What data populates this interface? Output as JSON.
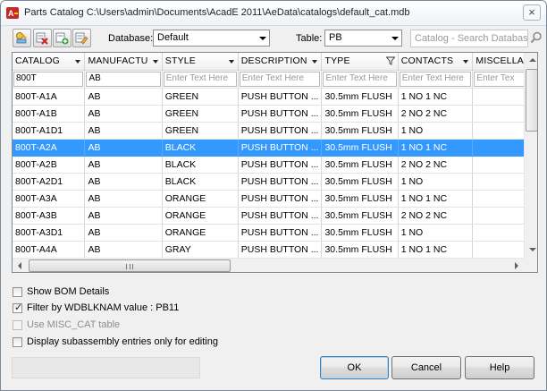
{
  "window": {
    "title": "Parts Catalog C:\\Users\\admin\\Documents\\AcadE 2011\\AeData\\catalogs\\default_cat.mdb",
    "close_glyph": "×"
  },
  "toolbar": {
    "database_label": "Database:",
    "database_value": "Default",
    "table_label": "Table:",
    "table_value": "PB",
    "search_placeholder": "Catalog - Search Database"
  },
  "grid": {
    "columns": [
      {
        "label": "CATALOG",
        "filter": "800T",
        "filter_is_value": true
      },
      {
        "label": "MANUFACTU",
        "filter": "AB",
        "filter_is_value": true
      },
      {
        "label": "STYLE",
        "filter": "Enter Text Here",
        "filter_is_value": false
      },
      {
        "label": "DESCRIPTION",
        "filter": "Enter Text Here",
        "filter_is_value": false
      },
      {
        "label": "TYPE",
        "filter": "Enter Text Here",
        "filter_is_value": false
      },
      {
        "label": "CONTACTS",
        "filter": "Enter Text Here",
        "filter_is_value": false
      },
      {
        "label": "MISCELLA",
        "filter": "Enter Tex",
        "filter_is_value": false
      }
    ],
    "rows": [
      [
        "800T-A1A",
        "AB",
        "GREEN",
        "PUSH BUTTON ...",
        "30.5mm FLUSH",
        "1 NO 1 NC",
        ""
      ],
      [
        "800T-A1B",
        "AB",
        "GREEN",
        "PUSH BUTTON ...",
        "30.5mm FLUSH",
        "2 NO 2 NC",
        ""
      ],
      [
        "800T-A1D1",
        "AB",
        "GREEN",
        "PUSH BUTTON ...",
        "30.5mm FLUSH",
        "1 NO",
        ""
      ],
      [
        "800T-A2A",
        "AB",
        "BLACK",
        "PUSH BUTTON ...",
        "30.5mm FLUSH",
        "1 NO 1 NC",
        ""
      ],
      [
        "800T-A2B",
        "AB",
        "BLACK",
        "PUSH BUTTON ...",
        "30.5mm FLUSH",
        "2 NO 2 NC",
        ""
      ],
      [
        "800T-A2D1",
        "AB",
        "BLACK",
        "PUSH BUTTON ...",
        "30.5mm FLUSH",
        "1 NO",
        ""
      ],
      [
        "800T-A3A",
        "AB",
        "ORANGE",
        "PUSH BUTTON ...",
        "30.5mm FLUSH",
        "1 NO 1 NC",
        ""
      ],
      [
        "800T-A3B",
        "AB",
        "ORANGE",
        "PUSH BUTTON ...",
        "30.5mm FLUSH",
        "2 NO 2 NC",
        ""
      ],
      [
        "800T-A3D1",
        "AB",
        "ORANGE",
        "PUSH BUTTON ...",
        "30.5mm FLUSH",
        "1 NO",
        ""
      ],
      [
        "800T-A4A",
        "AB",
        "GRAY",
        "PUSH BUTTON ...",
        "30.5mm FLUSH",
        "1 NO 1 NC",
        ""
      ]
    ],
    "selected_row_index": 3,
    "selection_color": "#3399ff"
  },
  "options": [
    {
      "label": "Show BOM Details",
      "checked": false,
      "disabled": false
    },
    {
      "label": "Filter by WDBLKNAM value : PB11",
      "checked": true,
      "disabled": false
    },
    {
      "label": "Use MISC_CAT table",
      "checked": false,
      "disabled": true
    },
    {
      "label": "Display subassembly entries only for editing",
      "checked": false,
      "disabled": false
    }
  ],
  "buttons": {
    "ok": "OK",
    "cancel": "Cancel",
    "help": "Help"
  },
  "icons": {
    "title": "acade-app-icon",
    "toolbar": [
      "edit-record-icon",
      "delete-record-icon",
      "add-record-icon",
      "copy-edit-record-icon"
    ],
    "search": "search-icon",
    "filter": "filter-funnel-icon"
  }
}
